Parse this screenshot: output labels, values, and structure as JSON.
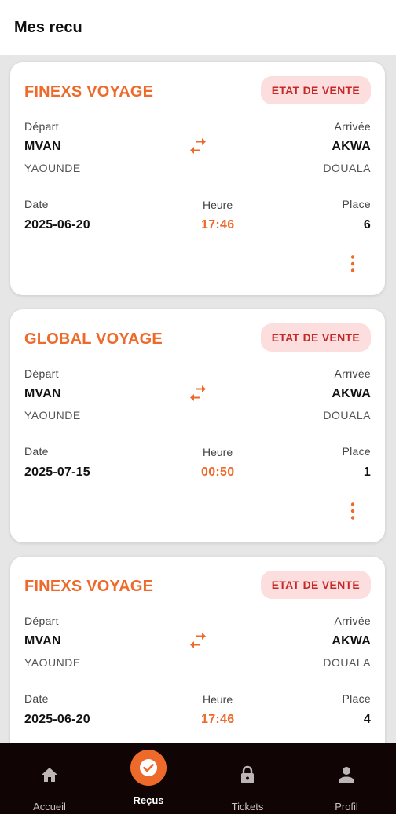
{
  "header": {
    "title": "Mes recu"
  },
  "labels": {
    "depart": "Départ",
    "arrivee": "Arrivée",
    "date": "Date",
    "heure": "Heure",
    "place": "Place"
  },
  "receipts": [
    {
      "company": "FINEXS VOYAGE",
      "status": "ETAT DE VENTE",
      "from_code": "MVAN",
      "from_city": "YAOUNDE",
      "to_code": "AKWA",
      "to_city": "DOUALA",
      "date": "2025-06-20",
      "time": "17:46",
      "seat": "6"
    },
    {
      "company": "GLOBAL VOYAGE",
      "status": "ETAT DE VENTE",
      "from_code": "MVAN",
      "from_city": "YAOUNDE",
      "to_code": "AKWA",
      "to_city": "DOUALA",
      "date": "2025-07-15",
      "time": "00:50",
      "seat": "1"
    },
    {
      "company": "FINEXS VOYAGE",
      "status": "ETAT DE VENTE",
      "from_code": "MVAN",
      "from_city": "YAOUNDE",
      "to_code": "AKWA",
      "to_city": "DOUALA",
      "date": "2025-06-20",
      "time": "17:46",
      "seat": "4"
    }
  ],
  "icons": {
    "swap": "swap-horiz-icon",
    "more": "more-vert-icon"
  },
  "bottom_nav": {
    "items": [
      {
        "label": "Accueil",
        "icon": "home-icon",
        "active": false
      },
      {
        "label": "Reçus",
        "icon": "check-circle-icon",
        "active": true
      },
      {
        "label": "Tickets",
        "icon": "lock-icon",
        "active": false
      },
      {
        "label": "Profil",
        "icon": "person-icon",
        "active": false
      }
    ]
  },
  "colors": {
    "accent": "#ee6a2b",
    "badge_bg": "#fcdede",
    "badge_text": "#c62828",
    "nav_bg": "#100404"
  }
}
